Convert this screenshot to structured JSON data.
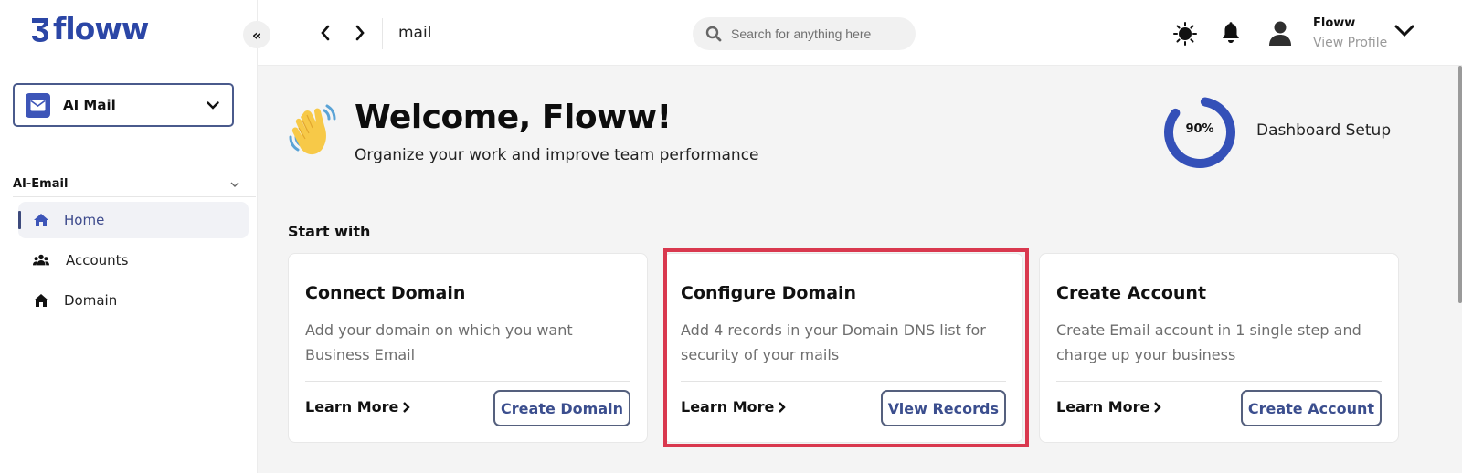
{
  "sidebar": {
    "logo_text": "floww",
    "collapse_label": "«",
    "app_selector": {
      "label": "AI Mail"
    },
    "section": {
      "label": "AI-Email"
    },
    "items": [
      {
        "label": "Home",
        "icon": "home-icon",
        "active": true
      },
      {
        "label": "Accounts",
        "icon": "users-icon",
        "active": false
      },
      {
        "label": "Domain",
        "icon": "home-icon",
        "active": false
      }
    ]
  },
  "topbar": {
    "breadcrumb": "mail",
    "search": {
      "placeholder": "Search for anything here",
      "value": ""
    },
    "user": {
      "name": "Floww",
      "subtitle": "View Profile"
    }
  },
  "main": {
    "welcome_title": "Welcome, Floww!",
    "welcome_subtitle": "Organize your work and improve team performance",
    "setup": {
      "progress_percent": 90,
      "progress_label": "90%",
      "label": "Dashboard Setup"
    },
    "start_with_label": "Start with",
    "cards": [
      {
        "title": "Connect Domain",
        "description": "Add your domain on which you want Business Email",
        "learn_more": "Learn More",
        "action": "Create Domain",
        "highlighted": false
      },
      {
        "title": "Configure Domain",
        "description": "Add 4 records in your Domain DNS list for security of your mails",
        "learn_more": "Learn More",
        "action": "View Records",
        "highlighted": true
      },
      {
        "title": "Create Account",
        "description": "Create Email account in 1 single step and charge up your business",
        "learn_more": "Learn More",
        "action": "Create Account",
        "highlighted": false
      }
    ]
  },
  "colors": {
    "brand": "#2b46a6",
    "accent": "#3d55b8",
    "highlight": "#d9384e",
    "button_text": "#3b4e8e"
  }
}
